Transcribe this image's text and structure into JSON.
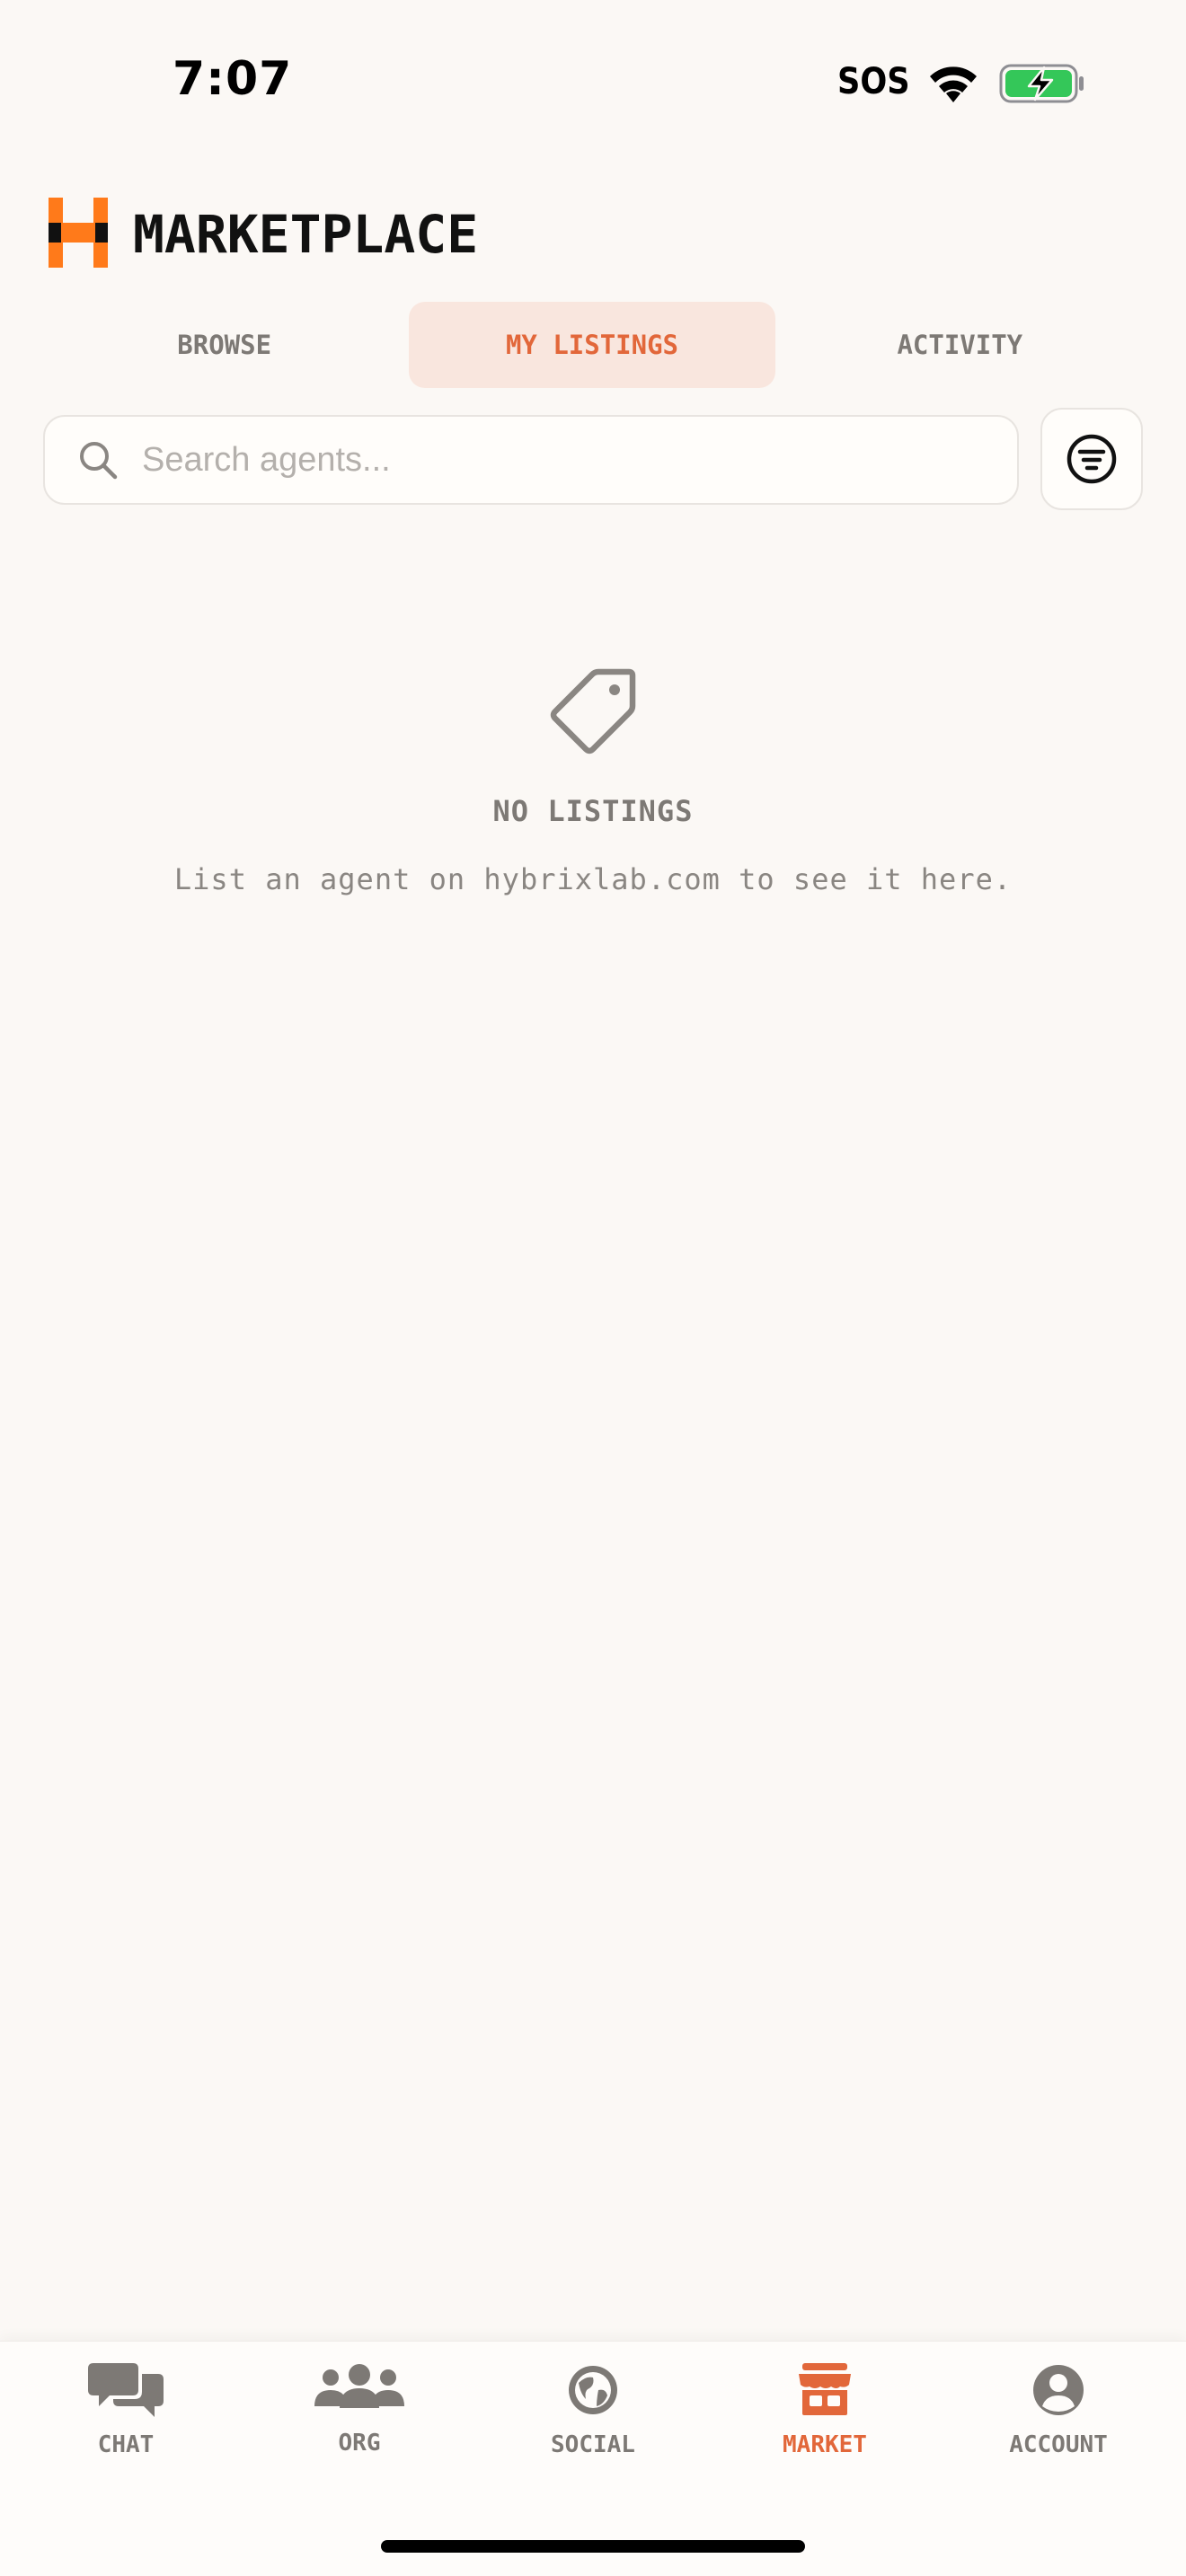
{
  "status_bar": {
    "time": "7:07",
    "sos": "SOS",
    "icons": [
      "wifi-icon",
      "battery-charging-icon"
    ],
    "battery_color": "#34c759"
  },
  "header": {
    "title": "MARKETPLACE",
    "logo": "hybrix-logo",
    "accent_color": "#ff7a1a"
  },
  "tabs": [
    {
      "label": "BROWSE",
      "active": false
    },
    {
      "label": "MY LISTINGS",
      "active": true
    },
    {
      "label": "ACTIVITY",
      "active": false
    }
  ],
  "search": {
    "placeholder": "Search agents...",
    "value": "",
    "icon": "search-icon",
    "filter_icon": "filter-icon"
  },
  "empty_state": {
    "icon": "tag-icon",
    "title": "NO LISTINGS",
    "message": "List an agent on hybrixlab.com to see it here."
  },
  "bottom_nav": {
    "active_color": "#e2673a",
    "inactive_color": "#7d7975",
    "items": [
      {
        "label": "CHAT",
        "icon": "chat-bubbles-icon",
        "active": false
      },
      {
        "label": "ORG",
        "icon": "people-icon",
        "active": false
      },
      {
        "label": "SOCIAL",
        "icon": "globe-icon",
        "active": false
      },
      {
        "label": "MARKET",
        "icon": "storefront-icon",
        "active": true
      },
      {
        "label": "ACCOUNT",
        "icon": "account-icon",
        "active": false
      }
    ]
  }
}
